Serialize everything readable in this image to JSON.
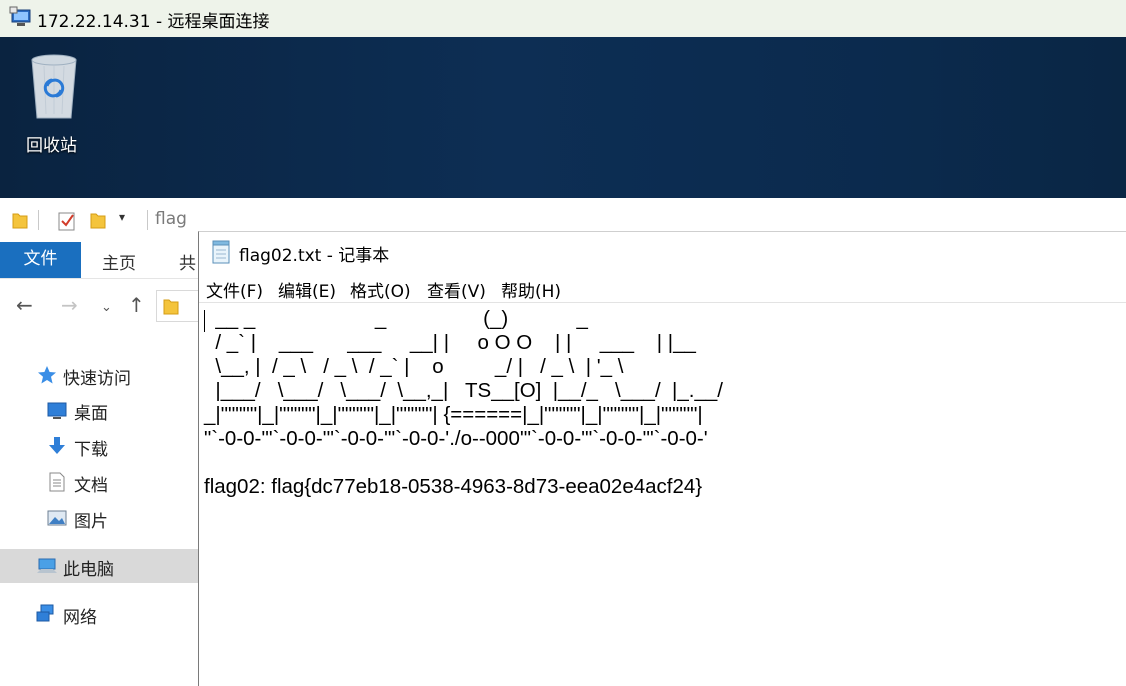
{
  "rdp": {
    "title": "172.22.14.31 - 远程桌面连接"
  },
  "desktop": {
    "recycle_bin_label": "回收站"
  },
  "explorer": {
    "window_title": "flag",
    "tabs": [
      "文件",
      "主页",
      "共"
    ],
    "nav_items": [
      {
        "label": "快速访问",
        "icon": "star-icon"
      },
      {
        "label": "桌面",
        "icon": "desktop-icon"
      },
      {
        "label": "下载",
        "icon": "download-arrow-icon"
      },
      {
        "label": "文档",
        "icon": "document-icon"
      },
      {
        "label": "图片",
        "icon": "pictures-icon"
      },
      {
        "label": "此电脑",
        "icon": "computer-icon"
      },
      {
        "label": "网络",
        "icon": "network-icon"
      }
    ]
  },
  "notepad": {
    "title": "flag02.txt - 记事本",
    "menu": [
      "文件(F)",
      "编辑(E)",
      "格式(O)",
      "查看(V)",
      "帮助(H)"
    ],
    "lines": [
      "  __ _                     _                 (_)            _",
      "  / _` |    ___      ___     __| |     o O O    | |     ___    | |__",
      "  \\__, |  / _ \\   / _ \\  / _` |    o         _/ |   / _ \\  | '_ \\",
      "  |___/   \\___/   \\___/  \\__,_|   TS__[O]  |__/_   \\___/  |_.__/",
      "_|\"\"\"\"\"|_|\"\"\"\"\"|_|\"\"\"\"\"|_|\"\"\"\"\"| {======|_|\"\"\"\"\"|_|\"\"\"\"\"|_|\"\"\"\"\"|",
      "\"`-0-0-'\"`-0-0-'\"`-0-0-'\"`-0-0-'./o--000'\"`-0-0-'\"`-0-0-'\"`-0-0-'",
      "",
      "flag02: flag{dc77eb18-0538-4963-8d73-eea02e4acf24}"
    ]
  }
}
